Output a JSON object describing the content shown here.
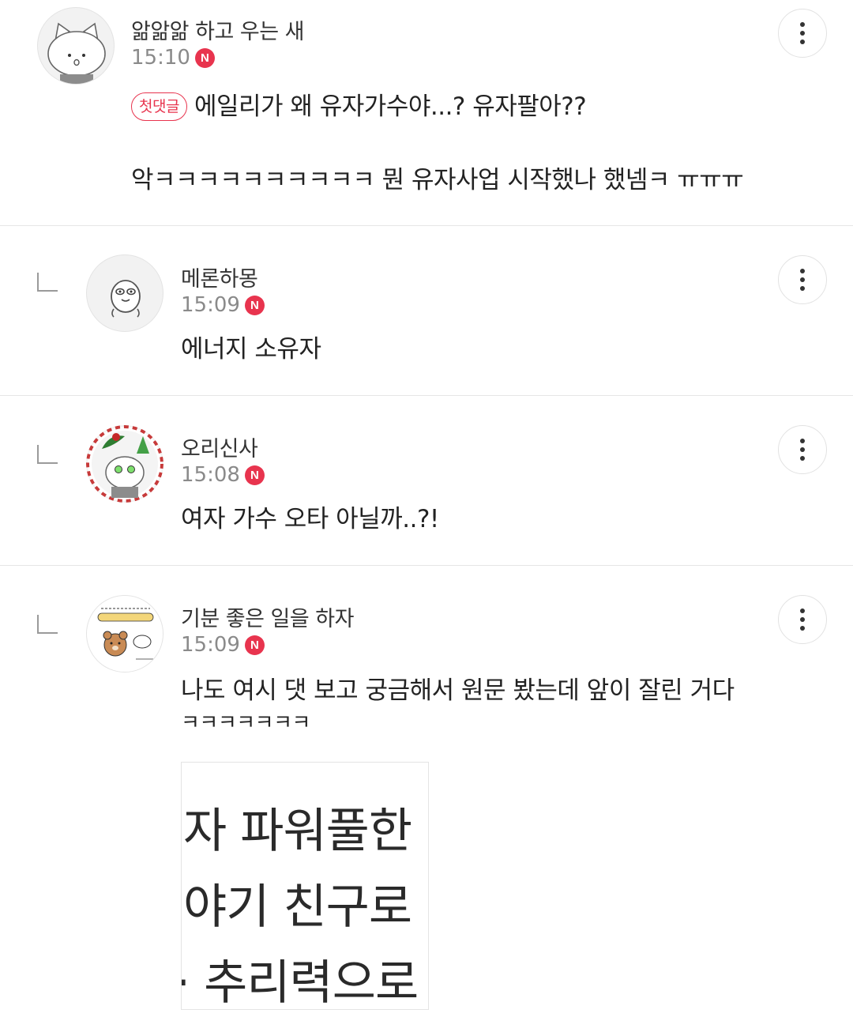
{
  "comments": [
    {
      "nickname": "앎앎앎 하고 우는 새",
      "time": "15:10",
      "badge": "N",
      "first_comment_label": "첫댓글",
      "text_lines": [
        "에일리가 왜 유자가수야...? 유자팔아??",
        "악ㅋㅋㅋㅋㅋㅋㅋㅋㅋㅋ 뭔 유자사업 시작했나 했넴ㅋ ㅠㅠㅠ"
      ]
    },
    {
      "nickname": "메론하몽",
      "time": "15:09",
      "badge": "N",
      "text_lines": [
        "에너지 소유자"
      ]
    },
    {
      "nickname": "오리신사",
      "time": "15:08",
      "badge": "N",
      "text_lines": [
        "여자 가수 오타 아닐까..?!"
      ]
    },
    {
      "nickname": "기분 좋은 일을 하자",
      "time": "15:09",
      "badge": "N",
      "text_lines": [
        "나도 여시 댓 보고 궁금해서 원문 봤는데 앞이 잘린 거다",
        "ㅋㅋㅋㅋㅋㅋㅋ"
      ],
      "image_lines": [
        "자 파워풀한 ",
        "야기 친구로 ",
        "· 추리력으로 "
      ]
    }
  ],
  "colors": {
    "accent": "#e8344e",
    "meta": "#8a8a8a",
    "divider": "#e6e6e6"
  },
  "icons": {
    "more": "more-vertical-icon",
    "reply": "reply-arrow-icon",
    "new": "new-badge-icon"
  }
}
